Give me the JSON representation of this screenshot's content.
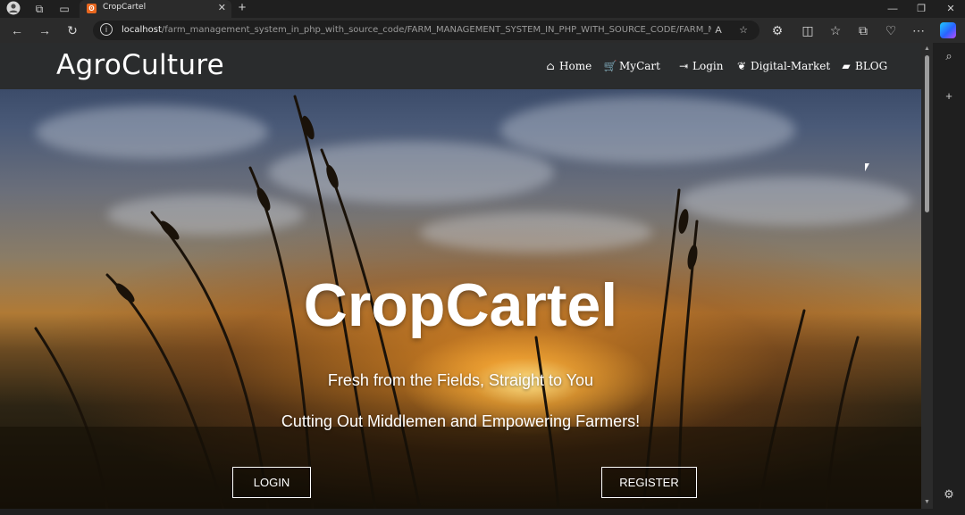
{
  "browser": {
    "tab_title": "CropCartel",
    "url_host": "localhost",
    "url_path": "/farm_management_system_in_php_with_source_code/FARM_MANAGEMENT_SYSTEM_IN_PHP_WITH_SOURCE_CODE/FARM_MANAGEMENT..."
  },
  "navbar": {
    "brand": "AgroCulture",
    "items": [
      {
        "label": "Home",
        "icon": "home-icon"
      },
      {
        "label": "MyCart",
        "icon": "cart-icon"
      },
      {
        "label": "Login",
        "icon": "login-icon"
      },
      {
        "label": "Digital-Market",
        "icon": "leaf-icon"
      },
      {
        "label": "BLOG",
        "icon": "comment-icon"
      }
    ]
  },
  "hero": {
    "title": "CropCartel",
    "subtitle_1": "Fresh from the Fields, Straight to You",
    "subtitle_2": "Cutting Out Middlemen and Empowering Farmers!",
    "login_label": "LOGIN",
    "register_label": "REGISTER"
  },
  "colors": {
    "navbar_bg": "#2a2c2d",
    "browser_bg": "#1f1f1f",
    "accent_tab_icon": "#e8671f"
  }
}
